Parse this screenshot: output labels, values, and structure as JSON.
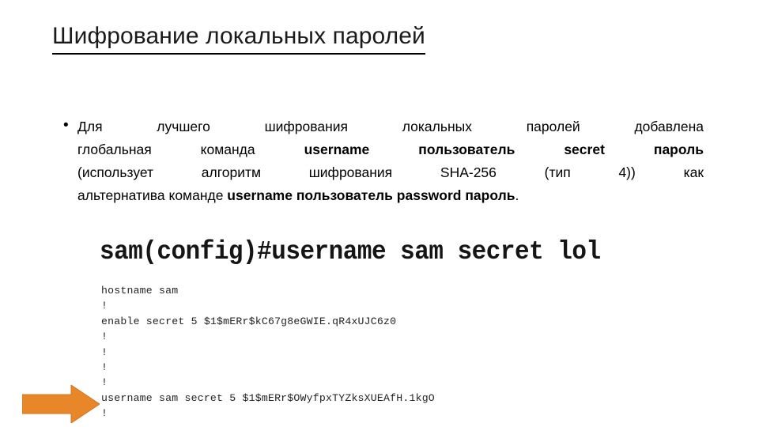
{
  "slide": {
    "title": "Шифрование локальных паролей"
  },
  "bullet": {
    "marker": "•",
    "lines": [
      {
        "justified": true,
        "segments": [
          {
            "text": "Для",
            "bold": false
          },
          {
            "text": "лучшего",
            "bold": false
          },
          {
            "text": "шифрования",
            "bold": false
          },
          {
            "text": "локальных",
            "bold": false
          },
          {
            "text": "паролей",
            "bold": false
          },
          {
            "text": "добавлена",
            "bold": false
          }
        ]
      },
      {
        "justified": true,
        "segments": [
          {
            "text": "глобальная",
            "bold": false
          },
          {
            "text": "команда",
            "bold": false
          },
          {
            "text": "username",
            "bold": true
          },
          {
            "text": "пользователь",
            "bold": true
          },
          {
            "text": "secret",
            "bold": true
          },
          {
            "text": "пароль",
            "bold": true
          }
        ]
      },
      {
        "justified": true,
        "segments": [
          {
            "text": "(использует",
            "bold": false
          },
          {
            "text": "алгоритм",
            "bold": false
          },
          {
            "text": "шифрования",
            "bold": false
          },
          {
            "text": "SHA-256",
            "bold": false
          },
          {
            "text": "(тип",
            "bold": false
          },
          {
            "text": "4))",
            "bold": false
          },
          {
            "text": "как",
            "bold": false
          }
        ]
      },
      {
        "justified": false,
        "segments": [
          {
            "text": "альтернатива команде ",
            "bold": false
          },
          {
            "text": "username пользователь password пароль",
            "bold": true
          },
          {
            "text": ".",
            "bold": false
          }
        ]
      }
    ]
  },
  "terminal": {
    "prompt_line": "sam(config)#username sam secret lol",
    "config_lines": [
      "hostname sam",
      "!",
      "enable secret 5 $1$mERr$kC67g8eGWIE.qR4xUJC6z0",
      "!",
      "!",
      "!",
      "!",
      "username sam secret 5 $1$mERr$OWyfpxTYZksXUEAfH.1kgO",
      "!"
    ]
  },
  "callout": {
    "arrow_color": "#E8862A",
    "arrow_border": "#D2741F",
    "direction": "right"
  }
}
